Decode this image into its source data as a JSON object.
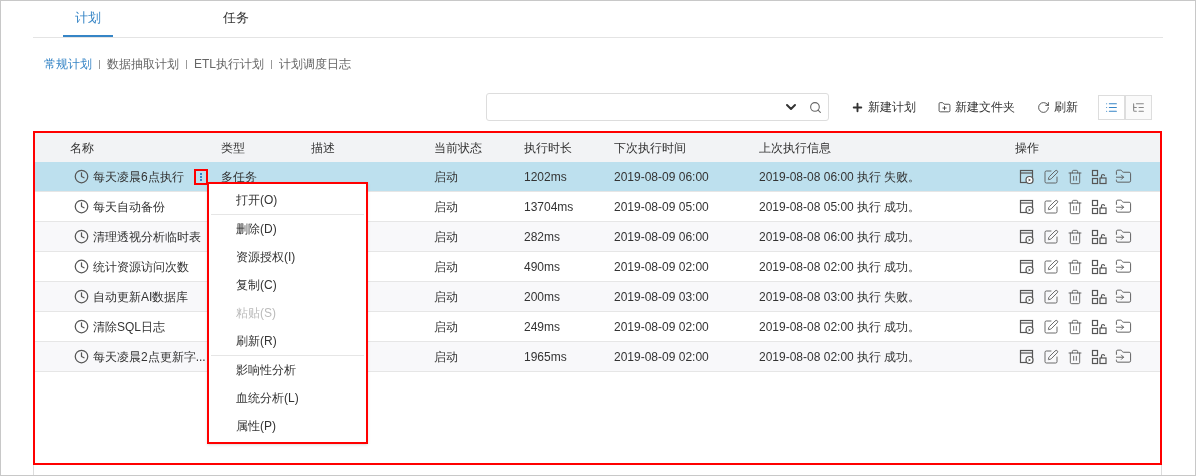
{
  "tabs": [
    {
      "label": "计划",
      "selected": true
    },
    {
      "label": "任务",
      "selected": false
    }
  ],
  "sub_tabs": [
    {
      "label": "常规计划",
      "selected": true
    },
    {
      "label": "数据抽取计划",
      "selected": false
    },
    {
      "label": "ETL执行计划",
      "selected": false
    },
    {
      "label": "计划调度日志",
      "selected": false
    }
  ],
  "toolbar": {
    "buttons": [
      {
        "kind": "add",
        "label": "新建计划"
      },
      {
        "kind": "folder",
        "label": "新建文件夹"
      },
      {
        "kind": "refresh",
        "label": "刷新"
      }
    ],
    "views": [
      {
        "kind": "list",
        "selected": true
      },
      {
        "kind": "tree",
        "selected": false
      }
    ]
  },
  "table": {
    "columns": [
      "名称",
      "类型",
      "描述",
      "当前状态",
      "执行时长",
      "下次执行时间",
      "上次执行信息",
      "操作"
    ],
    "rows": [
      {
        "name": "每天凌晨6点执行",
        "type": "多任务",
        "status": "启动",
        "duration": "1202ms",
        "next": "2019-08-09 06:00",
        "last": "2019-08-08 06:00 执行 失败。",
        "selected": true,
        "menu_open": true
      },
      {
        "name": "每天自动备份",
        "status": "启动",
        "duration": "13704ms",
        "next": "2019-08-09 05:00",
        "last": "2019-08-08 05:00 执行 成功。",
        "selected": false,
        "menu_open": false
      },
      {
        "name": "清理透视分析临时表",
        "status": "启动",
        "duration": "282ms",
        "next": "2019-08-09 06:00",
        "last": "2019-08-08 06:00 执行 成功。",
        "selected": false,
        "menu_open": false
      },
      {
        "name": "统计资源访问次数",
        "status": "启动",
        "duration": "490ms",
        "next": "2019-08-09 02:00",
        "last": "2019-08-08 02:00 执行 成功。",
        "selected": false,
        "menu_open": false
      },
      {
        "name": "自动更新AI数据库",
        "status": "启动",
        "duration": "200ms",
        "next": "2019-08-09 03:00",
        "last": "2019-08-08 03:00 执行 失败。",
        "selected": false,
        "menu_open": false
      },
      {
        "name": "清除SQL日志",
        "status": "启动",
        "duration": "249ms",
        "next": "2019-08-09 02:00",
        "last": "2019-08-08 02:00 执行 成功。",
        "selected": false,
        "menu_open": false
      },
      {
        "name": "每天凌晨2点更新字...",
        "status": "启动",
        "duration": "1965ms",
        "next": "2019-08-09 02:00",
        "last": "2019-08-08 02:00 执行 成功。",
        "selected": false,
        "menu_open": false
      }
    ]
  },
  "context_menu": [
    {
      "label": "打开(O)",
      "disabled": false,
      "divider_after": true
    },
    {
      "label": "删除(D)",
      "disabled": false,
      "divider_after": false
    },
    {
      "label": "资源授权(I)",
      "disabled": false,
      "divider_after": false
    },
    {
      "label": "复制(C)",
      "disabled": false,
      "divider_after": false
    },
    {
      "label": "粘贴(S)",
      "disabled": true,
      "divider_after": false
    },
    {
      "label": "刷新(R)",
      "disabled": false,
      "divider_after": true
    },
    {
      "label": "影响性分析",
      "disabled": false,
      "divider_after": false
    },
    {
      "label": "血统分析(L)",
      "disabled": false,
      "divider_after": false
    },
    {
      "label": "属性(P)",
      "disabled": false,
      "divider_after": false
    }
  ]
}
